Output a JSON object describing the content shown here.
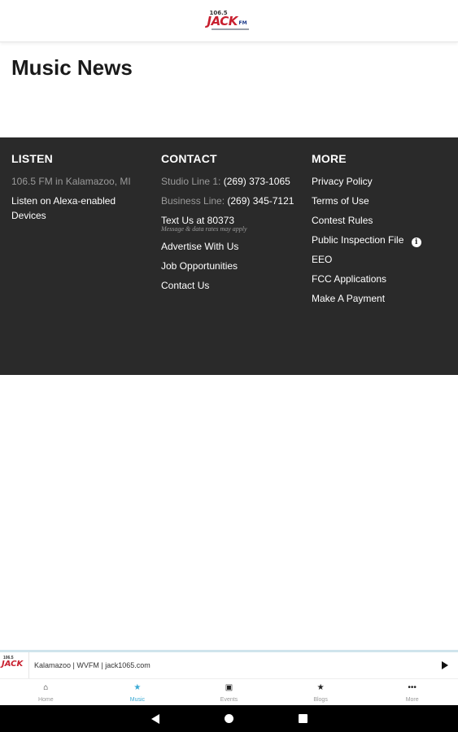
{
  "header": {
    "logo_number": "106.5",
    "logo_word": "JACK",
    "logo_suffix": "FM"
  },
  "page_title": "Music News",
  "footer": {
    "listen": {
      "heading": "LISTEN",
      "location": "106.5 FM in Kalamazoo, MI",
      "alexa": "Listen on Alexa-enabled Devices"
    },
    "contact": {
      "heading": "CONTACT",
      "studio_label": "Studio Line 1:",
      "studio_number": "(269) 373-1065",
      "business_label": "Business Line:",
      "business_number": "(269) 345-7121",
      "text_us": "Text Us at 80373",
      "text_disclaimer": "Message & data rates may apply",
      "advertise": "Advertise With Us",
      "jobs": "Job Opportunities",
      "contact_us": "Contact Us"
    },
    "more": {
      "heading": "MORE",
      "items": [
        "Privacy Policy",
        "Terms of Use",
        "Contest Rules",
        "Public Inspection File",
        "EEO",
        "FCC Applications",
        "Make A Payment"
      ]
    }
  },
  "player": {
    "logo_number": "106.5",
    "logo_word": "JACK",
    "station_text": "Kalamazoo | WVFM | jack1065.com",
    "play_icon": "play-icon"
  },
  "tabs": [
    {
      "label": "Home",
      "icon": "home-icon",
      "glyph": "⌂"
    },
    {
      "label": "Music",
      "icon": "star-icon",
      "glyph": "★"
    },
    {
      "label": "Events",
      "icon": "calendar-icon",
      "glyph": "▣"
    },
    {
      "label": "Blogs",
      "icon": "star-icon",
      "glyph": "★"
    },
    {
      "label": "More",
      "icon": "more-icon",
      "glyph": "•••"
    }
  ],
  "active_tab": "Music",
  "colors": {
    "accent": "#3aa9d4",
    "footer_bg": "#2a2a2a",
    "brand_red": "#c8202f"
  }
}
